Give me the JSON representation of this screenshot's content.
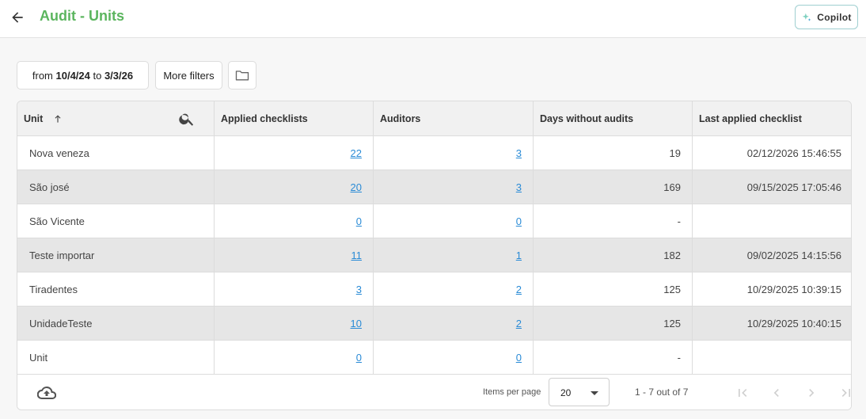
{
  "header": {
    "title": "Audit - Units",
    "copilot_label": "Copilot"
  },
  "filters": {
    "date_prefix": "from ",
    "date_from": "10/4/24",
    "date_mid": " to ",
    "date_to": "3/3/26",
    "more_filters_label": "More filters"
  },
  "table": {
    "columns": {
      "unit": "Unit",
      "applied": "Applied checklists",
      "auditors": "Auditors",
      "days": "Days without audits",
      "last": "Last applied checklist"
    },
    "rows": [
      {
        "unit": "Nova veneza",
        "applied": "22",
        "auditors": "3",
        "days": "19",
        "last": "02/12/2026 15:46:55"
      },
      {
        "unit": "São josé",
        "applied": "20",
        "auditors": "3",
        "days": "169",
        "last": "09/15/2025 17:05:46"
      },
      {
        "unit": "São Vicente",
        "applied": "0",
        "auditors": "0",
        "days": "-",
        "last": ""
      },
      {
        "unit": "Teste importar",
        "applied": "11",
        "auditors": "1",
        "days": "182",
        "last": "09/02/2025 14:15:56"
      },
      {
        "unit": "Tiradentes",
        "applied": "3",
        "auditors": "2",
        "days": "125",
        "last": "10/29/2025 10:39:15"
      },
      {
        "unit": "UnidadeTeste",
        "applied": "10",
        "auditors": "2",
        "days": "125",
        "last": "10/29/2025 10:40:15"
      },
      {
        "unit": "Unit",
        "applied": "0",
        "auditors": "0",
        "days": "-",
        "last": ""
      }
    ]
  },
  "pager": {
    "items_per_page_label": "Items per page",
    "items_per_page_value": "20",
    "range_label": "1 - 7 out of 7"
  },
  "colors": {
    "title_green": "#5bb55e",
    "link_blue": "#2a8bd6",
    "copilot_border": "#9fcfd0"
  },
  "icons": [
    "arrow-left-icon",
    "sparkle-icon",
    "folder-icon",
    "search-icon",
    "sort-asc-icon",
    "cloud-upload-icon",
    "first-page-icon",
    "prev-page-icon",
    "next-page-icon",
    "last-page-icon"
  ]
}
